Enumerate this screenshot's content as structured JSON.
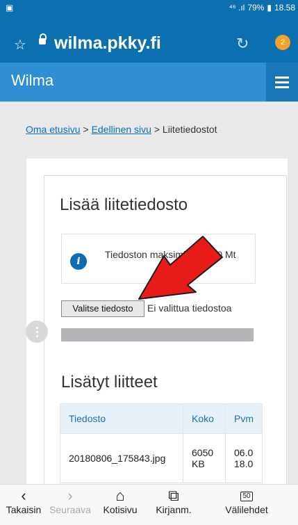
{
  "statusbar": {
    "signal": "⁴⁶ .ıl",
    "battery": "79%",
    "time": "18.58"
  },
  "browser": {
    "url": "wilma.pkky.fi",
    "tab_count": "2"
  },
  "appbar": {
    "title": "Wilma"
  },
  "breadcrumb": {
    "home": "Oma etusivu",
    "prev": "Edellinen sivu",
    "current": "Liitetiedostot",
    "sep": ">"
  },
  "upload": {
    "heading": "Lisää liitetiedosto",
    "info_text": "Tiedoston maksimikoko: 10 Mt",
    "choose_button": "Valitse tiedosto",
    "status": "Ei valittua tiedostoa"
  },
  "attachments": {
    "heading": "Lisätyt liitteet",
    "columns": [
      "Tiedosto",
      "Koko",
      "Pvm"
    ],
    "rows": [
      {
        "file": "20180806_175843.jpg",
        "size": "6050 KB",
        "date": "06.0 18.0"
      }
    ]
  },
  "nav": {
    "back": "Takaisin",
    "forward": "Seuraava",
    "home": "Kotisivu",
    "bookmarks": "Kirjanm.",
    "tabs": "Välilehdet",
    "tabs_count": "50"
  }
}
